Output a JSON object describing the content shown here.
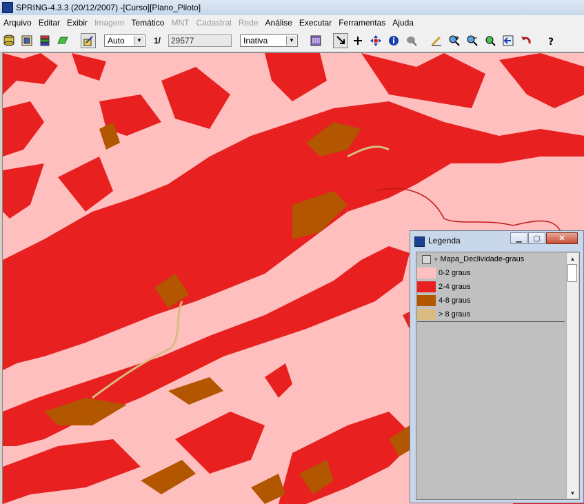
{
  "window": {
    "title": "SPRING-4.3.3 (20/12/2007) -[Curso][Plano_Piloto]",
    "icon": "app-icon"
  },
  "menu": [
    {
      "label": "Arquivo",
      "enabled": true
    },
    {
      "label": "Editar",
      "enabled": true
    },
    {
      "label": "Exibir",
      "enabled": true
    },
    {
      "label": "Imagem",
      "enabled": false
    },
    {
      "label": "Temático",
      "enabled": true
    },
    {
      "label": "MNT",
      "enabled": false
    },
    {
      "label": "Cadastral",
      "enabled": false
    },
    {
      "label": "Rede",
      "enabled": false
    },
    {
      "label": "Análise",
      "enabled": true
    },
    {
      "label": "Executar",
      "enabled": true
    },
    {
      "label": "Ferramentas",
      "enabled": true
    },
    {
      "label": "Ajuda",
      "enabled": true
    }
  ],
  "toolbar": {
    "zoom_mode": "Auto",
    "scale_prefix": "1/",
    "scale_value": "29577",
    "cursor_mode": "Inativa",
    "icons": [
      "database-icon",
      "project-icon",
      "layers-icon",
      "plane-icon",
      "draw-icon",
      "draw-area-icon",
      "pointer-icon",
      "pan-cross-icon",
      "move-icon",
      "info-icon",
      "cursor-icon",
      "edit-icon",
      "zoom-in-icon",
      "zoom-out-icon",
      "zoom-fit-icon",
      "back-icon",
      "undo-icon",
      "help-icon"
    ]
  },
  "legend": {
    "title": "Legenda",
    "layer_name": "Mapa_Declividade-graus",
    "classes": [
      {
        "label": "0-2 graus",
        "color": "#ffbfbf"
      },
      {
        "label": "2-4 graus",
        "color": "#e82020"
      },
      {
        "label": "4-8 graus",
        "color": "#b25600"
      },
      {
        "label": "> 8 graus",
        "color": "#d9bb83"
      }
    ]
  },
  "map_colors": {
    "background": "#ffbfbf",
    "class2": "#e82020",
    "class3": "#b25600",
    "class4": "#d9bb83"
  }
}
